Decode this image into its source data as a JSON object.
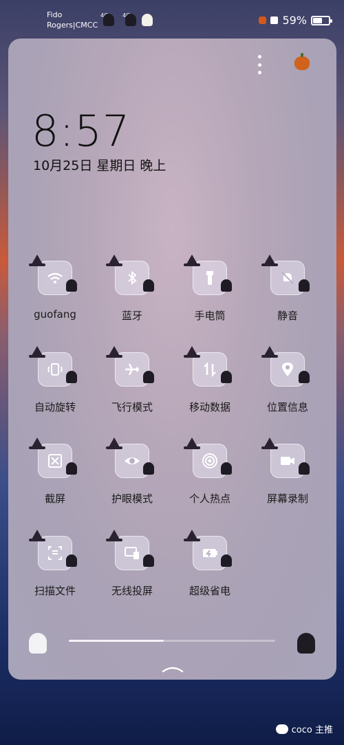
{
  "status_bar": {
    "carrier_line1": "Fido",
    "carrier_line2": "Rogers|CMCC",
    "signal_label_1": "4G",
    "signal_label_2": "4G",
    "battery_percent": "59%",
    "battery_level": 0.59
  },
  "lockscreen": {
    "time": "8:57",
    "date": "10月25日 星期日 晚上"
  },
  "quick_settings": {
    "tiles": [
      {
        "label": "guofang",
        "icon": "wifi-icon"
      },
      {
        "label": "蓝牙",
        "icon": "bluetooth-icon"
      },
      {
        "label": "手电筒",
        "icon": "flashlight-icon"
      },
      {
        "label": "静音",
        "icon": "bell-off-icon"
      },
      {
        "label": "自动旋转",
        "icon": "rotate-icon"
      },
      {
        "label": "飞行模式",
        "icon": "airplane-icon"
      },
      {
        "label": "移动数据",
        "icon": "data-icon"
      },
      {
        "label": "位置信息",
        "icon": "location-icon"
      },
      {
        "label": "截屏",
        "icon": "screenshot-icon"
      },
      {
        "label": "护眼模式",
        "icon": "eye-icon"
      },
      {
        "label": "个人热点",
        "icon": "hotspot-icon"
      },
      {
        "label": "屏幕录制",
        "icon": "screen-record-icon"
      },
      {
        "label": "扫描文件",
        "icon": "scan-icon"
      },
      {
        "label": "无线投屏",
        "icon": "cast-icon"
      },
      {
        "label": "超级省电",
        "icon": "battery-saver-icon"
      }
    ]
  },
  "brightness": {
    "level": 0.46
  },
  "watermark": {
    "text": "coco 主推"
  },
  "colors": {
    "icon": "#ffffff",
    "tile_bg": "#e6e1f0",
    "hat": "#2a2230"
  }
}
